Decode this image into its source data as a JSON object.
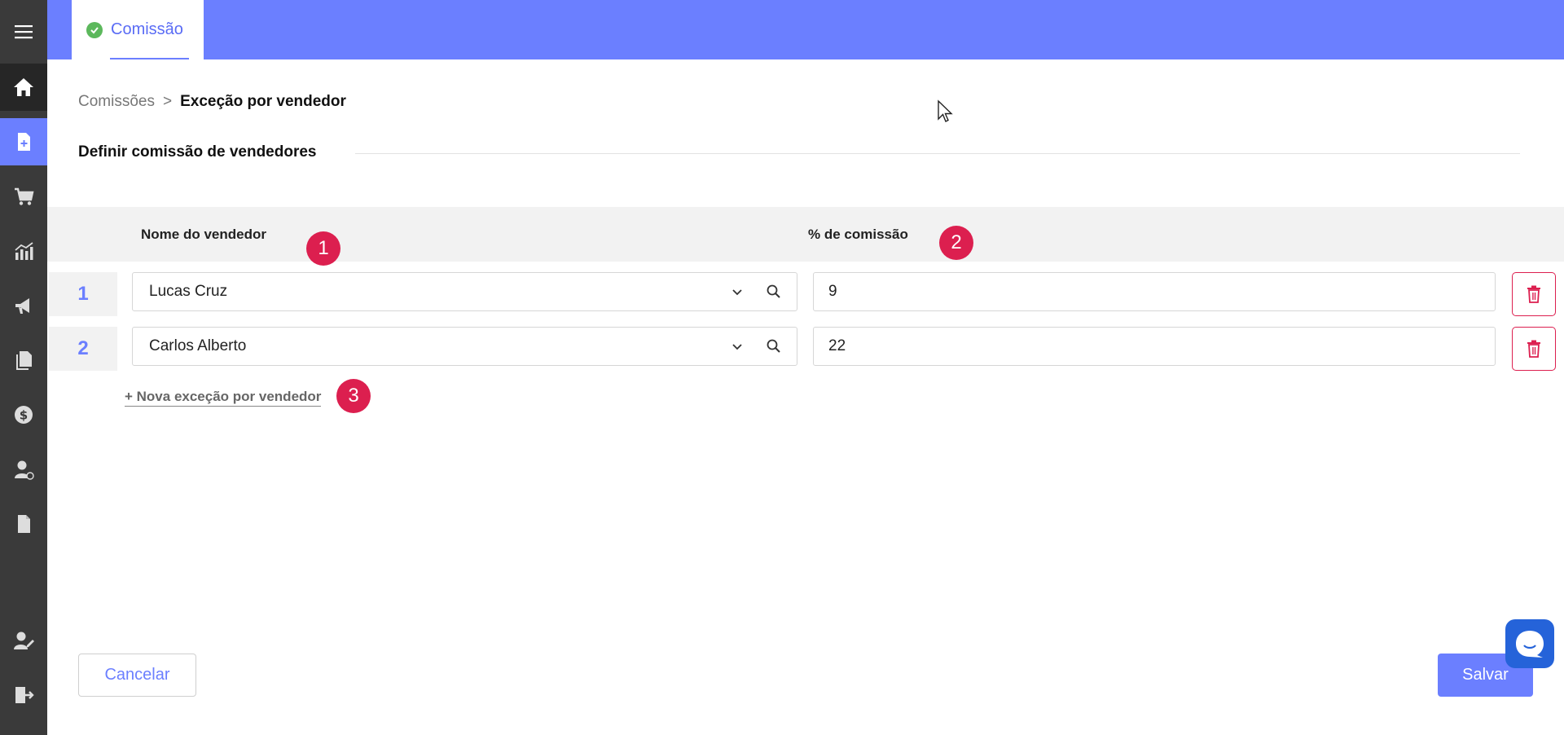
{
  "tab": {
    "label": "Comissão"
  },
  "breadcrumb": {
    "parent": "Comissões",
    "separator": ">",
    "current": "Exceção por vendedor"
  },
  "section": {
    "title": "Definir comissão de vendedores"
  },
  "table": {
    "headers": {
      "seller": "Nome do vendedor",
      "commission": "% de comissão"
    },
    "rows": [
      {
        "num": "1",
        "seller": "Lucas Cruz",
        "commission": "9"
      },
      {
        "num": "2",
        "seller": "Carlos Alberto",
        "commission": "22"
      }
    ]
  },
  "add_link": "+ Nova exceção por vendedor",
  "badges": [
    "1",
    "2",
    "3"
  ],
  "footer": {
    "cancel": "Cancelar",
    "save": "Salvar"
  },
  "colors": {
    "accent": "#6b7fff",
    "sidebar": "#3a3a3a",
    "danger": "#dc1f4f",
    "success": "#5cb85c",
    "chat": "#2563d9"
  }
}
